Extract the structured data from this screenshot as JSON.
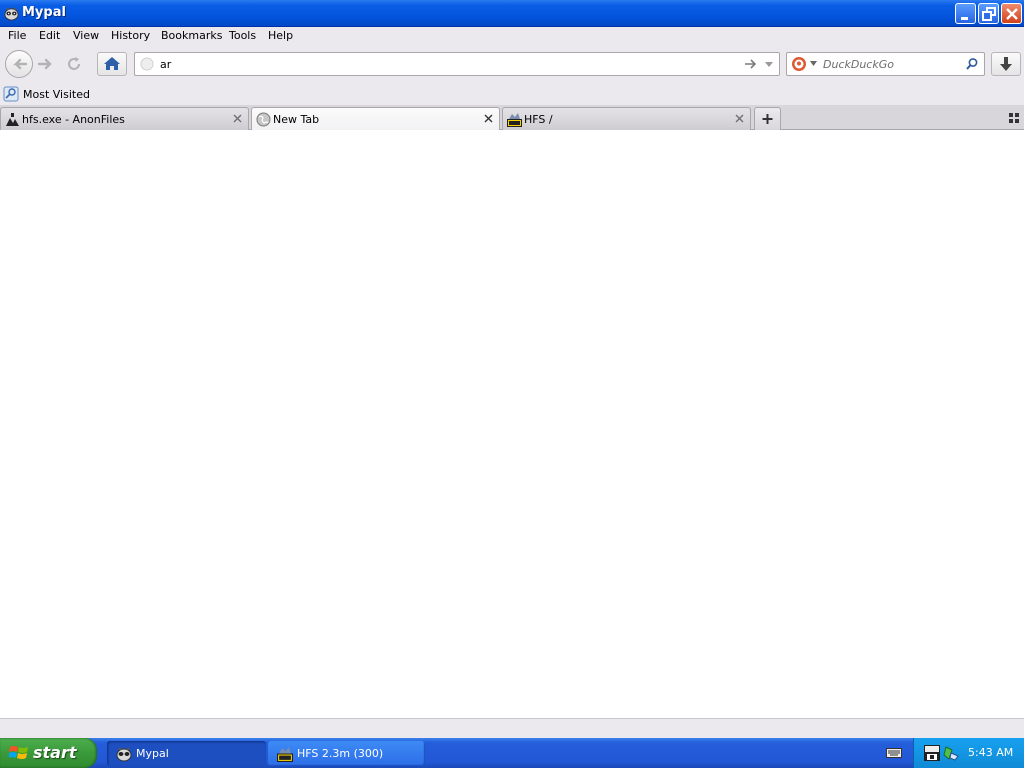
{
  "window": {
    "title": "Mypal"
  },
  "menubar": {
    "items": [
      "File",
      "Edit",
      "View",
      "History",
      "Bookmarks",
      "Tools",
      "Help"
    ]
  },
  "navbar": {
    "url_value": "ar",
    "search_engine": "DuckDuckGo",
    "search_placeholder": "DuckDuckGo"
  },
  "bookmarks": {
    "items": [
      {
        "label": "Most Visited",
        "icon": "bookmark-folder-icon"
      }
    ]
  },
  "tabs": [
    {
      "label": "hfs.exe - AnonFiles",
      "icon": "anonfiles-icon",
      "active": false
    },
    {
      "label": "New Tab",
      "icon": "globe-icon",
      "active": true
    },
    {
      "label": "HFS /",
      "icon": "hfs-icon",
      "active": false
    }
  ],
  "taskbar": {
    "start_label": "start",
    "tasks": [
      {
        "label": "Mypal",
        "icon": "mypal-icon",
        "active": true
      },
      {
        "label": "HFS 2.3m (300)",
        "icon": "hfs-icon",
        "active": false
      }
    ],
    "clock": "5:43 AM"
  },
  "colors": {
    "titlebar": "#0355dd",
    "chrome": "#ebe9ed",
    "taskbar": "#245edb",
    "start": "#3a9a3a",
    "tray": "#0f8ad6"
  }
}
